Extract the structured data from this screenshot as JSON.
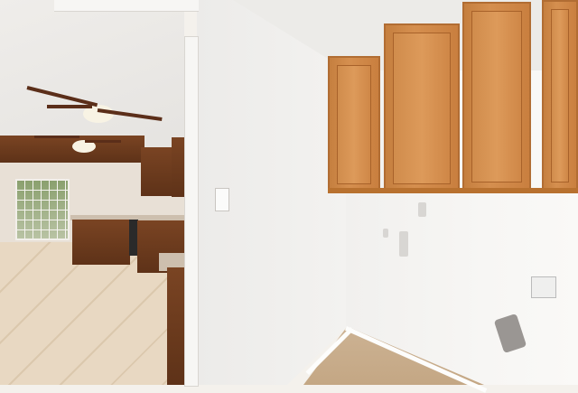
{
  "scene": {
    "description_label": "",
    "colors": {
      "cabinet_wood": "#c97f3f",
      "wall": "#f4f3f1",
      "floor_tile": "#c4a784",
      "dark_wood": "#6b3a1e"
    }
  }
}
